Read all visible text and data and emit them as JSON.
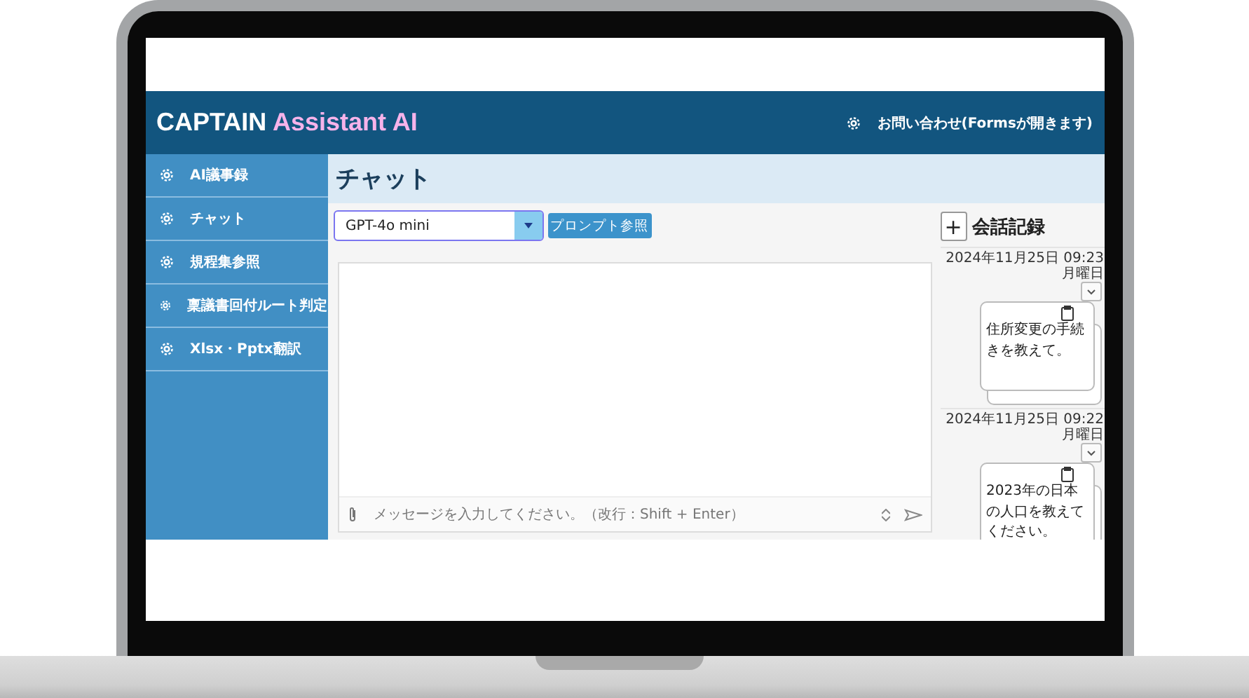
{
  "header": {
    "brand": "CAPTAIN",
    "brand_accent": "Assistant AI",
    "contact_link": "お問い合わせ(Formsが開きます)"
  },
  "sidebar": {
    "items": [
      {
        "label": "AI議事録"
      },
      {
        "label": "チャット"
      },
      {
        "label": "規程集参照"
      },
      {
        "label": "稟議書回付ルート判定"
      },
      {
        "label": "Xlsx・Pptx翻訳"
      }
    ]
  },
  "page_title": "チャット",
  "model_select": {
    "value": "GPT-4o mini"
  },
  "prompt_button": "プロンプト参照",
  "message_input": {
    "placeholder": "メッセージを入力してください。（改行：Shift + Enter）"
  },
  "history": {
    "new_button": "+",
    "title": "会話記録",
    "entries": [
      {
        "date": "2024年11月25日 09:23 月曜日",
        "text": "住所変更の手続きを教えて。"
      },
      {
        "date": "2024年11月25日 09:22 月曜日",
        "text": "2023年の日本の人口を教えてください。"
      }
    ]
  }
}
